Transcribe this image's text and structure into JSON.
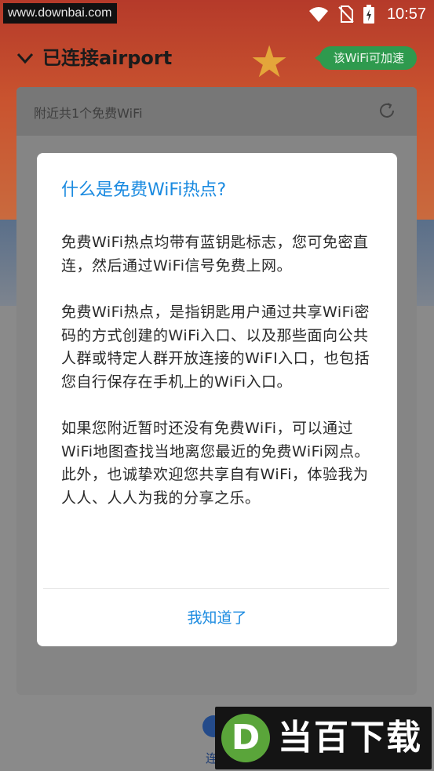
{
  "status_bar": {
    "watermark_url": "www.downbai.com",
    "time": "10:57",
    "icons": [
      "wifi-icon",
      "no-sim-icon",
      "battery-icon"
    ]
  },
  "header": {
    "title": "已连接airport",
    "accelerate_badge": "该WiFi可加速"
  },
  "card": {
    "nearby_text": "附近共1个免费WiFi",
    "icons": [
      "refresh-icon"
    ]
  },
  "bottom_nav": {
    "partial_label": "连"
  },
  "dialog": {
    "title": "什么是免费WiFi热点?",
    "paragraphs": [
      "免费WiFi热点均带有蓝钥匙标志，您可免密直连，然后通过WiFi信号免费上网。",
      "免费WiFi热点，是指钥匙用户通过共享WiFi密码的方式创建的WiFi入口、以及那些面向公共人群或特定人群开放连接的WiFI入口，也包括您自行保存在手机上的WiFi入口。",
      "如果您附近暂时还没有免费WiFi，可以通过WiFi地图查找当地离您最近的免费WiFi网点。此外，也诚挚欢迎您共享自有WiFi，体验我为人人、人人为我的分享之乐。"
    ],
    "ok_label": "我知道了"
  },
  "watermark": {
    "logo_letter": "D",
    "brand_text": "当百下载"
  },
  "colors": {
    "accent": "#1a8ae0",
    "badge_green": "#2e9a4e",
    "hero_red": "#b53a2a"
  }
}
